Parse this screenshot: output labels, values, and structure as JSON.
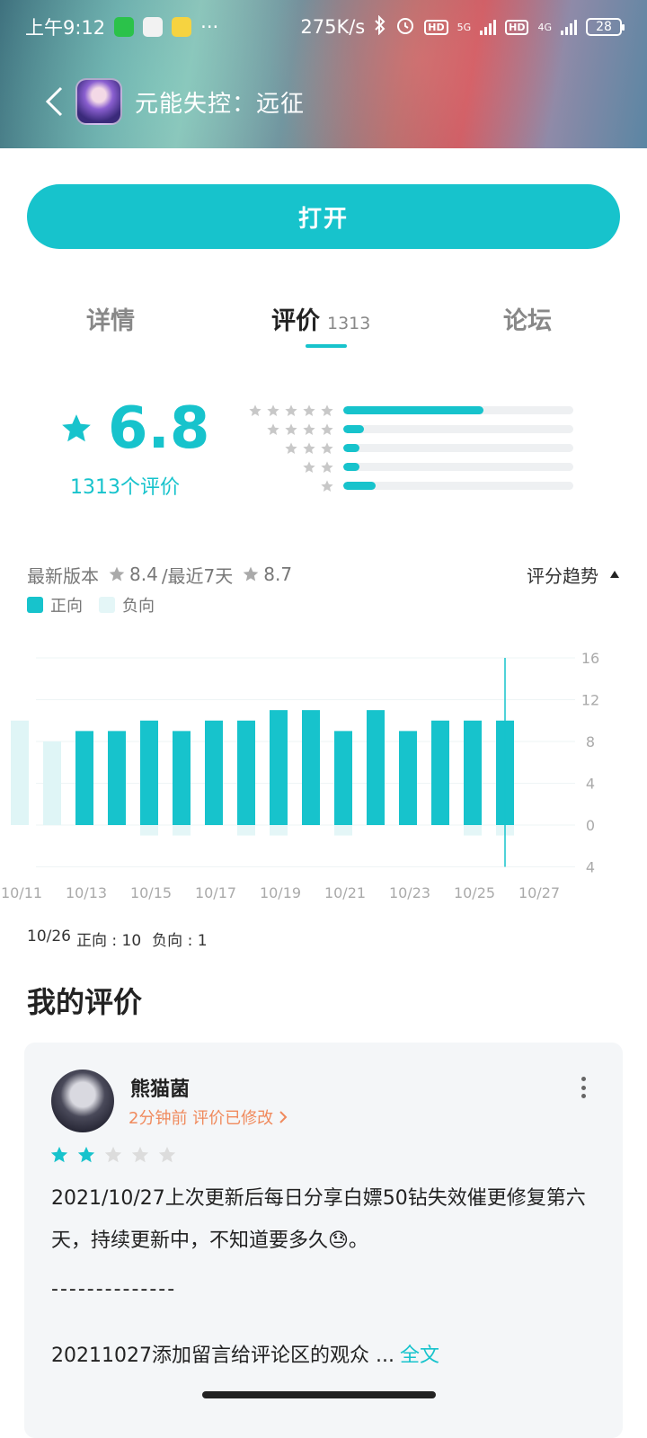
{
  "status_bar": {
    "time": "上午9:12",
    "more": "···",
    "speed": "275K/s",
    "network1": "5G",
    "network2": "4G",
    "battery": "28",
    "hd": "HD"
  },
  "header": {
    "app_title": "元能失控：远征"
  },
  "open_button": {
    "label": "打开"
  },
  "tabs": [
    {
      "label": "详情"
    },
    {
      "label": "评价",
      "count": "1313"
    },
    {
      "label": "论坛"
    }
  ],
  "rating": {
    "score": "6.8",
    "count_label": "1313个评价",
    "distribution": [
      {
        "stars": 5,
        "fraction": 0.61
      },
      {
        "stars": 4,
        "fraction": 0.09
      },
      {
        "stars": 3,
        "fraction": 0.07
      },
      {
        "stars": 2,
        "fraction": 0.07
      },
      {
        "stars": 1,
        "fraction": 0.14
      }
    ]
  },
  "version_line": {
    "latest_label": "最新版本",
    "latest_score": "8.4",
    "recent_label": "/最近7天",
    "recent_score": "8.7",
    "trend_label": "评分趋势"
  },
  "legend": {
    "positive": "正向",
    "negative": "负向"
  },
  "colors": {
    "accent": "#17c3cc",
    "negative_bar": "#e4f6f7",
    "meta_orange": "#f08a5d"
  },
  "chart_data": {
    "type": "bar",
    "categories": [
      "10/11",
      "10/12",
      "10/13",
      "10/14",
      "10/15",
      "10/16",
      "10/17",
      "10/18",
      "10/19",
      "10/20",
      "10/21",
      "10/22",
      "10/23",
      "10/24",
      "10/25",
      "10/26",
      "10/27"
    ],
    "x_tick_labels": [
      "10/11",
      "10/13",
      "10/15",
      "10/17",
      "10/19",
      "10/21",
      "10/23",
      "10/25",
      "10/27"
    ],
    "series": [
      {
        "name": "正向",
        "values": [
          10,
          8,
          9,
          9,
          10,
          9,
          10,
          10,
          11,
          11,
          9,
          11,
          9,
          10,
          10,
          10,
          0
        ]
      },
      {
        "name": "负向",
        "values": [
          0,
          0,
          0,
          0,
          1,
          1,
          0,
          1,
          1,
          0,
          1,
          0,
          0,
          0,
          1,
          1,
          0
        ]
      }
    ],
    "faded_categories": [
      "10/11",
      "10/12"
    ],
    "y_ticks": [
      "16",
      "12",
      "8",
      "4",
      "0",
      "4"
    ],
    "ylim": [
      -4,
      16
    ],
    "selected_category": "10/26"
  },
  "day_detail": {
    "date": "10/26",
    "positive": "正向 : 10",
    "negative": "负向 : 1"
  },
  "my_review": {
    "section_title": "我的评价",
    "username": "熊猫菌",
    "meta": "2分钟前 评价已修改",
    "star_rating": 2,
    "text": "2021/10/27上次更新后每日分享白嫖50钻失效催更修复第六天，持续更新中，不知道要多久😓。",
    "separator": "--------------",
    "more_text": "20211027添加留言给评论区的观众 ...",
    "full_label": "全文"
  }
}
